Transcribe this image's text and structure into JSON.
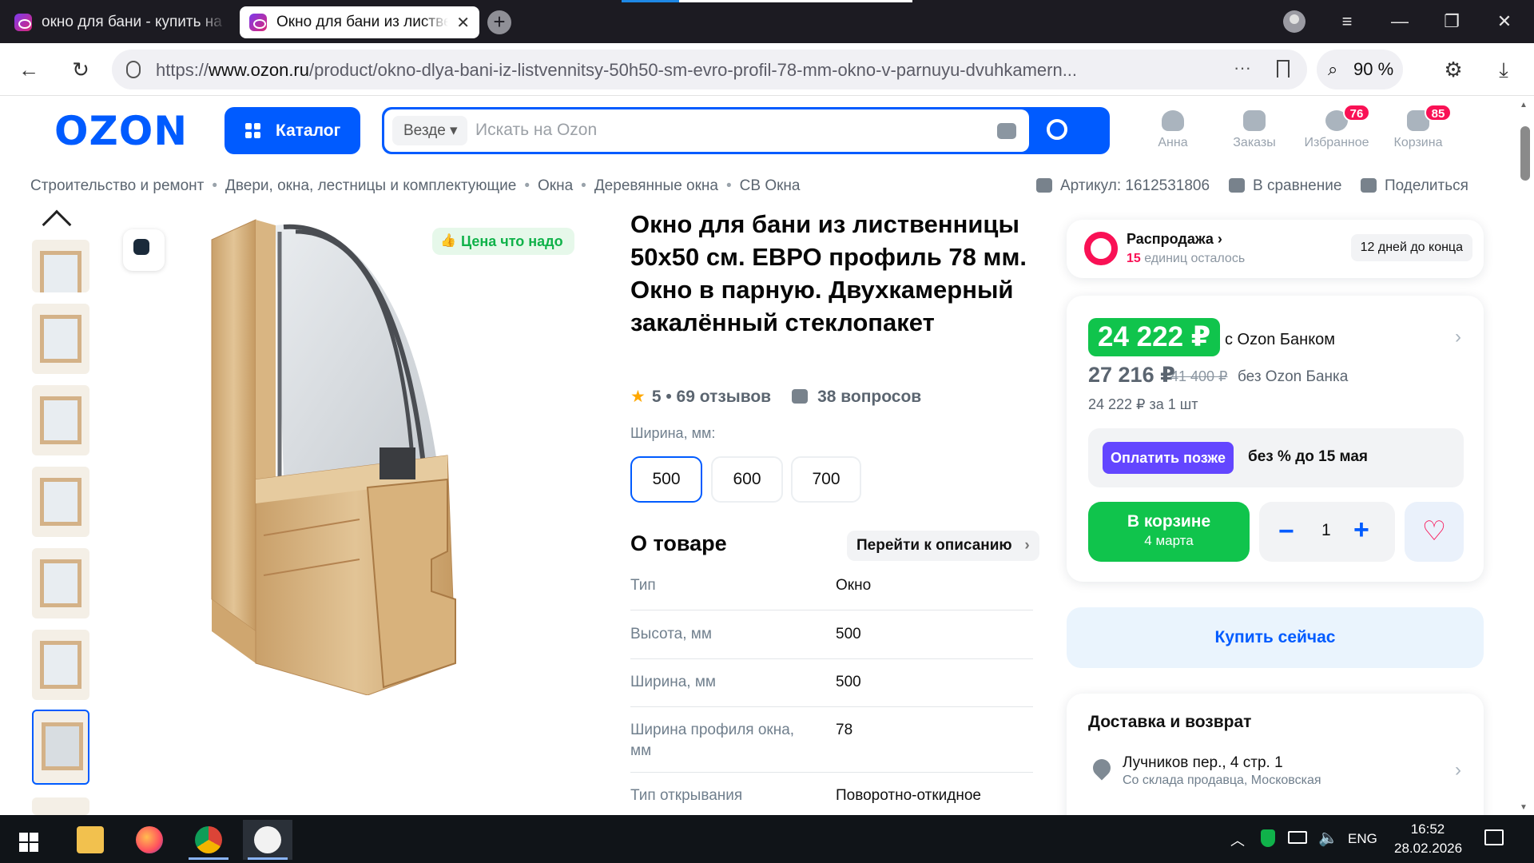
{
  "browser": {
    "tabs": [
      {
        "title": "окно для бани - купить на",
        "active": false
      },
      {
        "title": "Окно для бани из лиственницы",
        "active": true
      }
    ],
    "new_tab_glyph": "+",
    "url_prefix": "https://",
    "url_host": "www.ozon.ru",
    "url_path": "/product/okno-dlya-bani-iz-listvennitsy-50h50-sm-evro-profil-78-mm-okno-v-parnuyu-dvuhkamern...",
    "zoom": "90 %",
    "more_glyph": "···",
    "icons": [
      "back-icon",
      "reload-icon",
      "shield-icon",
      "bookmark-icon",
      "search-zoom-icon",
      "extensions-icon",
      "download-icon",
      "menu-icon",
      "minimize-icon",
      "restore-icon",
      "close-icon"
    ]
  },
  "header": {
    "logo": "OZON",
    "catalog_label": "Каталог",
    "search_scope": "Везде",
    "search_placeholder": "Искать на Ozon",
    "user": {
      "label": "Анна"
    },
    "orders": {
      "label": "Заказы"
    },
    "favorites": {
      "label": "Избранное",
      "count": "76"
    },
    "cart": {
      "label": "Корзина",
      "count": "85"
    }
  },
  "breadcrumbs": [
    "Строительство и ремонт",
    "Двери, окна, лестницы и комплектующие",
    "Окна",
    "Деревянные окна",
    "СВ Окна"
  ],
  "actions": {
    "sku": "Артикул: 1612531806",
    "compare": "В сравнение",
    "share": "Поделиться"
  },
  "gallery": {
    "badge": "Цена что надо",
    "thumb_count": 8
  },
  "product": {
    "title": "Окно для бани из лиственницы 50х50 см. ЕВРО профиль 78 мм. Окно в парную. Двухкамерный закалённый стеклопакет",
    "rating": "5",
    "reviews": "69 отзывов",
    "questions": "38 вопросов",
    "width_label": "Ширина, мм:",
    "width_options": [
      "500",
      "600",
      "700"
    ],
    "width_selected": "500",
    "about_title": "О товаре",
    "to_description": "Перейти к описанию",
    "props": [
      {
        "k": "Тип",
        "v": "Окно"
      },
      {
        "k": "Высота, мм",
        "v": "500"
      },
      {
        "k": "Ширина, мм",
        "v": "500"
      },
      {
        "k": "Ширина профиля окна, мм",
        "v": "78"
      },
      {
        "k": "Тип открывания",
        "v": "Поворотно-откидное"
      }
    ]
  },
  "sale": {
    "title": "Распродажа",
    "left_count": "15",
    "left_text": "единиц осталось",
    "ends": "12 дней до конца"
  },
  "price": {
    "bank_price": "24 222 ₽",
    "bank_label": "с Ozon Банком",
    "price": "27 216 ₽",
    "old_price": "41 400 ₽",
    "no_bank_label": "без Ozon Банка",
    "unit_price": "24 222 ₽ за 1 шт",
    "pay_later_btn": "Оплатить позже",
    "pay_later_text": "без % до 15 мая",
    "cart_btn": "В корзине",
    "cart_date": "4 марта",
    "quantity": "1",
    "buy_now": "Купить сейчас"
  },
  "delivery": {
    "title": "Доставка и возврат",
    "address": "Лучников пер., 4 стр. 1",
    "address_sub": "Со склада продавца, Московская"
  },
  "taskbar": {
    "lang": "ENG",
    "time": "16:52",
    "date": "28.02.2026"
  }
}
